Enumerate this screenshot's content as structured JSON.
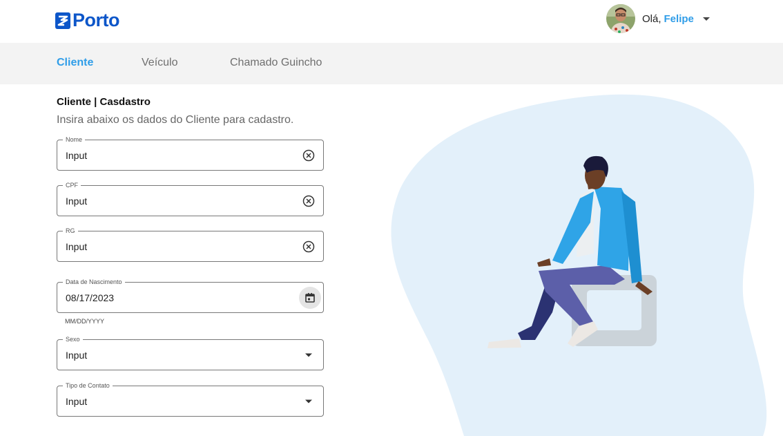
{
  "header": {
    "logo_text": "Porto",
    "greeting": "Olá,",
    "user_name": "Felipe"
  },
  "tabs": [
    {
      "label": "Cliente",
      "active": true
    },
    {
      "label": "Veículo",
      "active": false
    },
    {
      "label": "Chamado Guincho",
      "active": false
    }
  ],
  "form": {
    "title": "Cliente | Casdastro",
    "subtitle": "Insira abaixo os dados do Cliente para cadastro.",
    "fields": [
      {
        "label": "Nome",
        "value": "Input",
        "icon": "clear-icon"
      },
      {
        "label": "CPF",
        "value": "Input",
        "icon": "clear-icon"
      },
      {
        "label": "RG",
        "value": "Input",
        "icon": "clear-icon"
      },
      {
        "label": "Data de Nascimento",
        "value": "08/17/2023",
        "icon": "calendar-icon",
        "helper": "MM/DD/YYYY"
      },
      {
        "label": "Sexo",
        "value": "Input",
        "icon": "dropdown-arrow-icon"
      },
      {
        "label": "Tipo de Contato",
        "value": "Input",
        "icon": "dropdown-arrow-icon"
      }
    ]
  },
  "colors": {
    "brand": "#0d56c9",
    "accent": "#2f9de8",
    "tabbar_bg": "#f3f3f3",
    "blob": "#e3f0fa"
  }
}
